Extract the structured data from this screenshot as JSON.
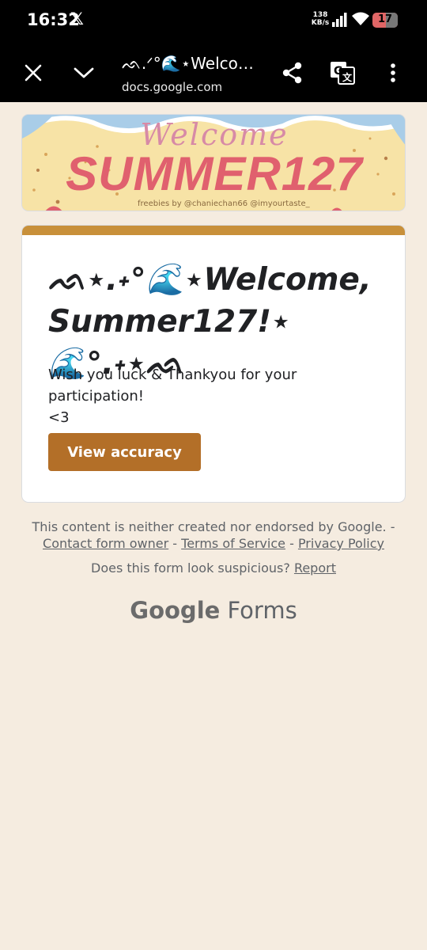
{
  "status_bar": {
    "time": "16:32",
    "x_logo": "𝕏",
    "network_speed_value": "138",
    "network_speed_unit": "KB/s",
    "battery": "17",
    "battery_level": 0.17
  },
  "app_bar": {
    "title": "ᨒ.ᐟ°🌊⋆Welcome…",
    "url": "docs.google.com",
    "icons": [
      "close-icon",
      "chevron-down-icon",
      "share-icon",
      "translate-icon",
      "more-vert-icon"
    ]
  },
  "banner": {
    "heading_small": "Welcome",
    "heading_big": "SUMMER127",
    "credit": "freebies by @chaniechan66 @imyourtaste_"
  },
  "form": {
    "title": "ᨒ⋆.˖°🌊⋆Welcome, Summer127!⋆🌊°.˖⋆ᨒ",
    "message_line1": "Wish you luck & Thankyou for your participation!",
    "message_line2": "<3",
    "view_button": "View accuracy",
    "accent_color": "#c8903a",
    "button_color": "#b36f28"
  },
  "footer": {
    "disclaimer": "This content is neither created nor endorsed by Google. -",
    "link_contact": "Contact form owner",
    "sep1": " - ",
    "link_terms": "Terms of Service",
    "sep2": " - ",
    "link_privacy": "Privacy Policy",
    "suspicious": "Does this form look suspicious?",
    "link_report": "Report",
    "logo_google": "Google",
    "logo_forms": "Forms"
  }
}
